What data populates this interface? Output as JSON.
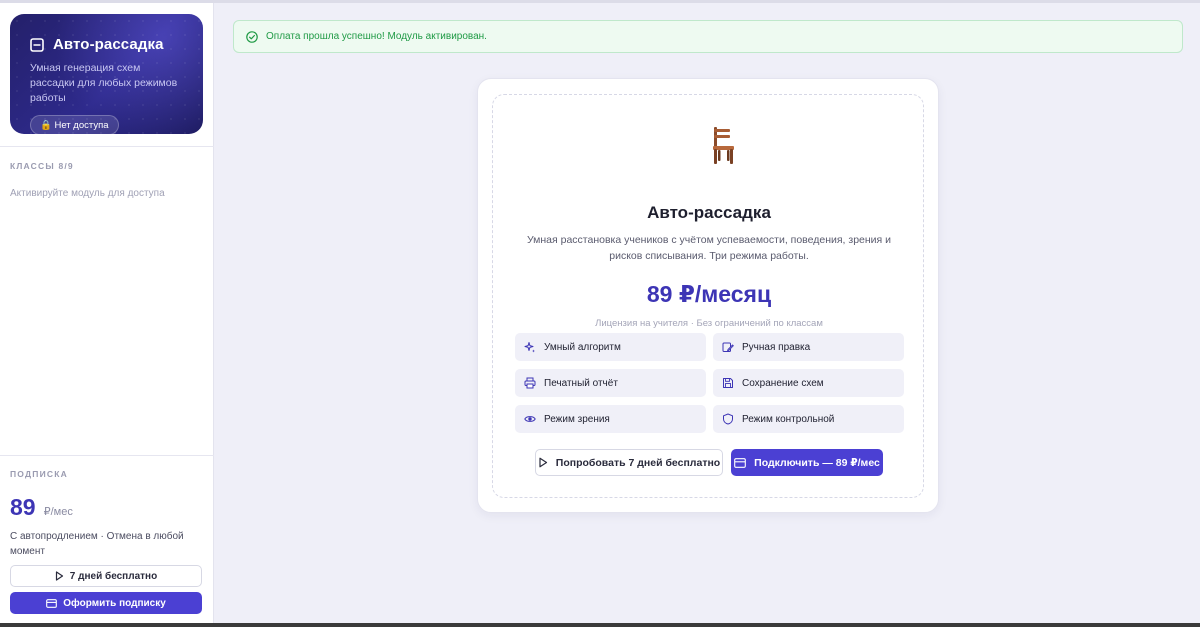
{
  "sidebar": {
    "hero": {
      "title": "Авто-рассадка",
      "subtitle": "Умная генерация схем рассадки для любых режимов работы",
      "badge": "🔒 Нет доступа"
    },
    "classes": {
      "heading": "КЛАССЫ 8/9",
      "empty_text": "Активируйте модуль для доступа"
    },
    "subscription": {
      "heading": "ПОДПИСКА",
      "price": "89",
      "unit": "₽/мес",
      "note": "С автопродлением · Отмена в любой момент",
      "trial_button": "7 дней бесплатно",
      "subscribe_button": "Оформить подписку"
    }
  },
  "alert": {
    "text": "Оплата прошла успешно! Модуль активирован."
  },
  "module": {
    "title": "Авто-рассадка",
    "description": "Умная расстановка учеников с учётом успеваемости, поведения, зрения и рисков списывания. Три режима работы.",
    "price": "89 ₽/месяц",
    "license": "Лицензия на учителя · Без ограничений по классам",
    "features": [
      {
        "label": "Умный алгоритм",
        "icon": "sparkles-icon"
      },
      {
        "label": "Ручная правка",
        "icon": "edit-icon"
      },
      {
        "label": "Печатный отчёт",
        "icon": "printer-icon"
      },
      {
        "label": "Сохранение схем",
        "icon": "save-icon"
      },
      {
        "label": "Режим зрения",
        "icon": "eye-icon"
      },
      {
        "label": "Режим контрольной",
        "icon": "shield-icon"
      }
    ],
    "trial_button": "Попробовать 7 дней бесплатно",
    "connect_button": "Подключить — 89 ₽/мес"
  },
  "colors": {
    "accent": "#4b40d3",
    "price": "#3d35b5",
    "success": "#1f9a45"
  }
}
